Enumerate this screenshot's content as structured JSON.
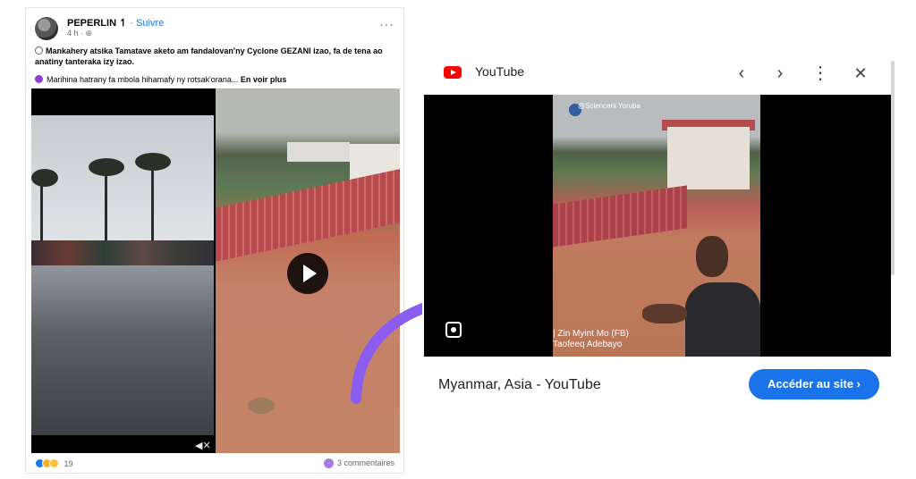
{
  "facebook_post": {
    "author": "PEPERLIN",
    "author_suffix": "↿",
    "separator": "·",
    "follow_label": "Suivre",
    "time": "4 h · ⊛",
    "more_label": "···",
    "caption": "Mankahery atsika Tamatave aketo am fandalovan'ny Cyclone GEZANI  izao, fa de tena ao anatiny tanteraka izy izao.",
    "subcaption": "Marihina hatrany fa mbola hihamafy ny rotsak'orana...",
    "see_more_label": "En voir plus",
    "reaction_count": "19",
    "comments_label": "3 commentaires",
    "mute_icon": "◀✕"
  },
  "youtube_result": {
    "source_title": "YouTube",
    "watermark": "@Scienceni Yoruba",
    "credit_line1": "| Zin Myint Mo (FB)",
    "credit_line2": "Taofeeq Adebayo",
    "result_title": "Myanmar, Asia - YouTube",
    "visit_button_label": "Accéder au site ›",
    "back_label": "‹",
    "forward_label": "›",
    "menu_label": "⋮",
    "close_label": "✕"
  },
  "colors": {
    "arrow": "#8a5cf0",
    "link_blue": "#1877f2",
    "button_blue": "#1a73e8",
    "youtube_red": "#ff0000"
  }
}
